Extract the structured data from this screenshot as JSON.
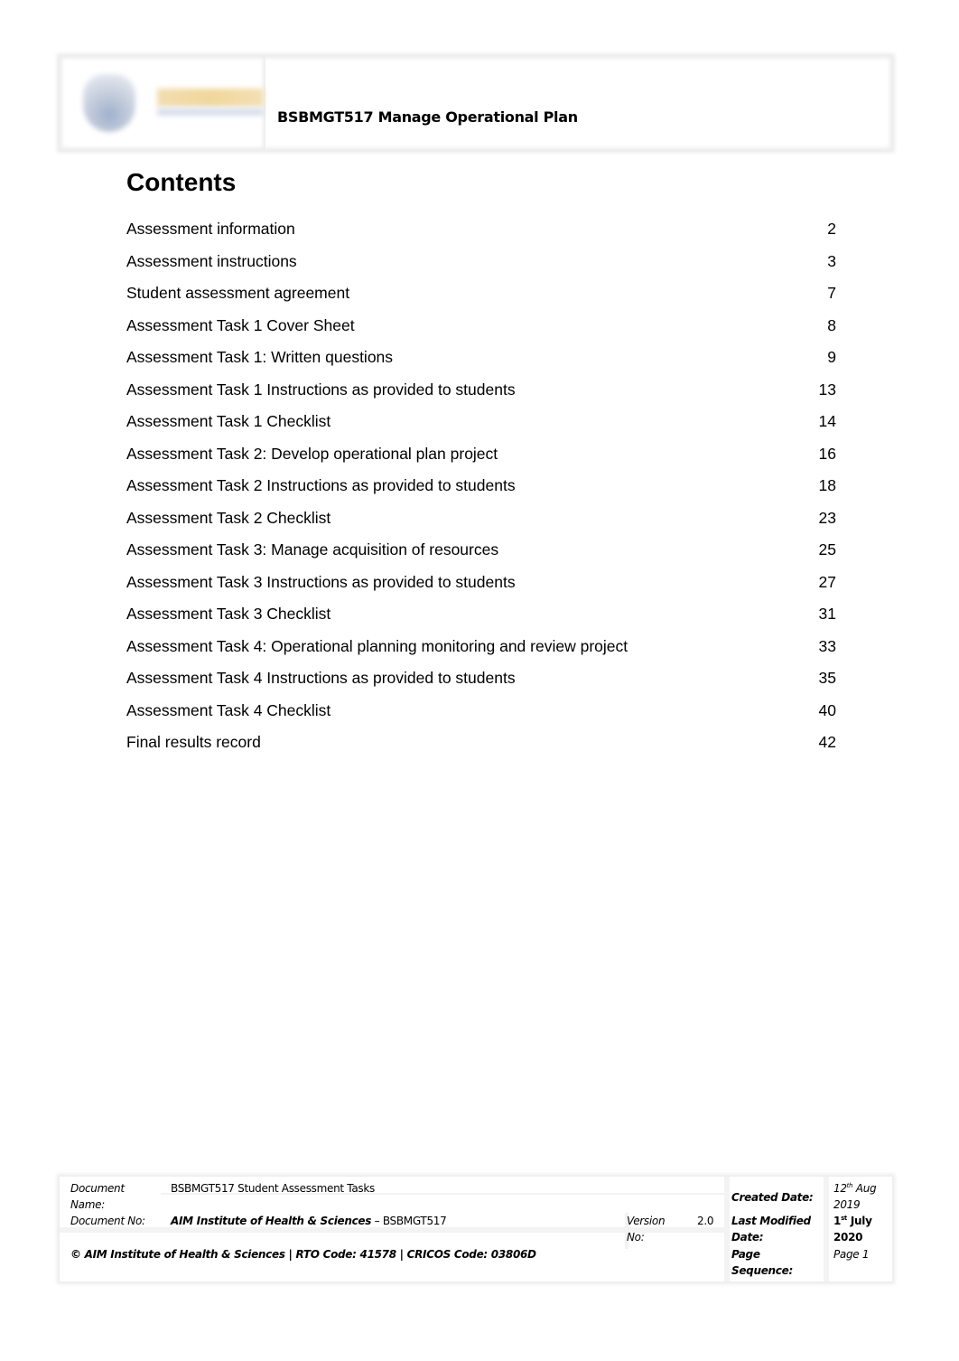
{
  "header": {
    "logo": "institute-logo",
    "title": "BSBMGT517 Manage Operational Plan"
  },
  "toc": {
    "heading": "Contents",
    "items": [
      {
        "label": "Assessment information",
        "page": "2"
      },
      {
        "label": "Assessment instructions",
        "page": "3"
      },
      {
        "label": "Student assessment agreement",
        "page": "7"
      },
      {
        "label": "Assessment Task 1 Cover Sheet",
        "page": "8"
      },
      {
        "label": "Assessment Task 1: Written questions",
        "page": "9"
      },
      {
        "label": "Assessment Task 1 Instructions as provided to students",
        "page": "13"
      },
      {
        "label": "Assessment Task 1 Checklist",
        "page": "14"
      },
      {
        "label": "Assessment Task 2: Develop operational plan project",
        "page": "16"
      },
      {
        "label": "Assessment Task 2 Instructions as provided to students",
        "page": "18"
      },
      {
        "label": "Assessment Task 2 Checklist",
        "page": "23"
      },
      {
        "label": "Assessment Task 3: Manage acquisition of resources",
        "page": "25"
      },
      {
        "label": "Assessment Task 3 Instructions as provided to students",
        "page": "27"
      },
      {
        "label": "Assessment Task 3 Checklist",
        "page": "31"
      },
      {
        "label": "Assessment Task 4: Operational planning monitoring and review project",
        "page": "33"
      },
      {
        "label": "Assessment Task 4 Instructions as provided to students",
        "page": "35"
      },
      {
        "label": "Assessment Task 4 Checklist",
        "page": "40"
      },
      {
        "label": "Final results record",
        "page": "42"
      }
    ]
  },
  "footer": {
    "doc_name_label_1": "Document",
    "doc_name_label_2": "Name:",
    "doc_name_value": "BSBMGT517 Student Assessment Tasks",
    "doc_no_label": "Document No:",
    "doc_no_org": "AIM Institute of Health & Sciences",
    "doc_no_code": " – BSBMGT517",
    "version_label_1": "Version",
    "version_label_2": "No:",
    "version_value": "2.0",
    "copyright": "© AIM Institute of Health & Sciences | RTO Code: 41578 | CRICOS Code: 03806D",
    "created_label": "Created Date:",
    "created_day": "12",
    "created_day_suffix": "th",
    "created_month": " Aug",
    "created_year": "2019",
    "modified_label_1": "Last Modified",
    "modified_label_2": "Date:",
    "modified_day": "1",
    "modified_day_suffix": "st",
    "modified_month": " July",
    "modified_year": "2020",
    "page_seq_label_1": "Page",
    "page_seq_label_2": "Sequence:",
    "page_seq_value": "Page 1"
  }
}
